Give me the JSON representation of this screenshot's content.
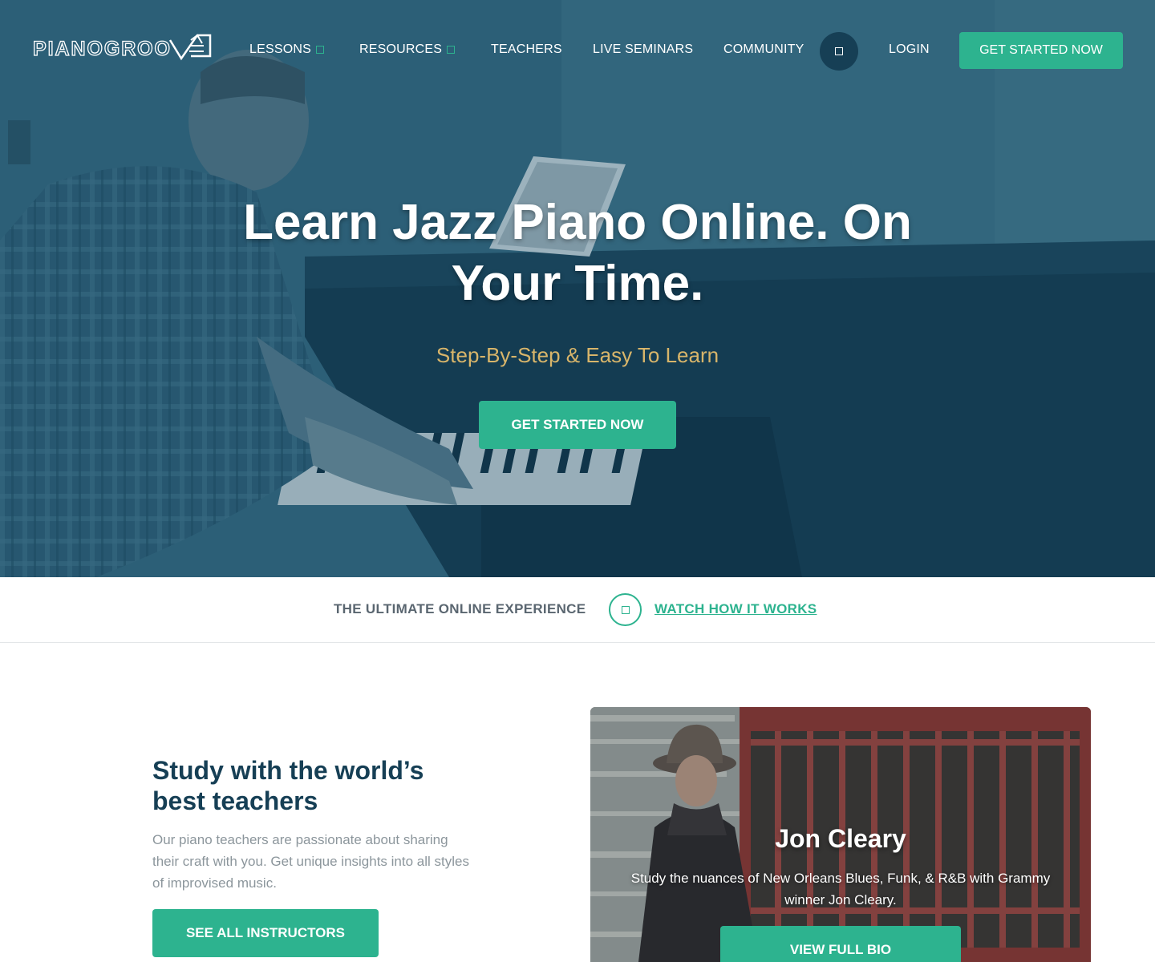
{
  "brand": {
    "logo_text": "PIANOGROOVE"
  },
  "nav": {
    "items": [
      {
        "label": "LESSONS",
        "has_dropdown": true
      },
      {
        "label": "RESOURCES",
        "has_dropdown": true
      },
      {
        "label": "TEACHERS",
        "has_dropdown": false
      },
      {
        "label": "LIVE SEMINARS",
        "has_dropdown": false
      },
      {
        "label": "COMMUNITY",
        "has_dropdown": false
      }
    ],
    "search_icon": "search-icon",
    "login_label": "LOGIN",
    "cta_label": "GET STARTED NOW"
  },
  "hero": {
    "title": "Learn Jazz Piano Online. On Your Time.",
    "subtitle": "Step-By-Step & Easy To Learn",
    "cta_label": "GET STARTED NOW"
  },
  "strip": {
    "label": "THE ULTIMATE ONLINE EXPERIENCE",
    "play_icon": "play-icon",
    "link_label": "WATCH HOW IT WORKS"
  },
  "teachers": {
    "title": "Study with the world’s best teachers",
    "body": "Our piano teachers are passionate about sharing their craft with you. Get unique insights into all styles of improvised music.",
    "cta_label": "SEE ALL INSTRUCTORS"
  },
  "featured_teacher": {
    "name": "Jon Cleary",
    "description": "Study the nuances of New Orleans Blues, Funk, & R&B with Grammy winner Jon Cleary.",
    "cta_label": "VIEW FULL BIO"
  },
  "colors": {
    "accent": "#2db38f",
    "navy": "#163f55",
    "gold": "#d8b56a",
    "muted_text": "#8c969c"
  }
}
